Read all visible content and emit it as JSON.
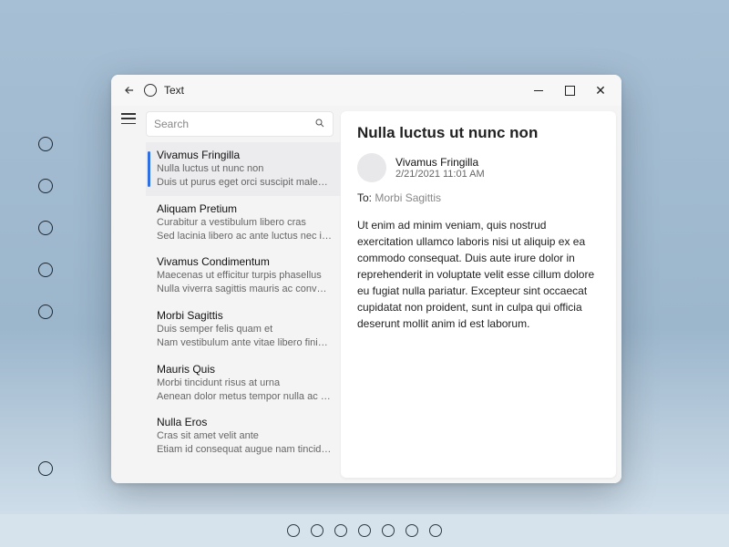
{
  "window": {
    "title": "Text"
  },
  "search": {
    "placeholder": "Search"
  },
  "list": [
    {
      "title": "Vivamus Fringilla",
      "line2": "Nulla luctus ut nunc non",
      "line3": "Duis ut purus eget orci suscipit malesuada",
      "selected": true
    },
    {
      "title": "Aliquam Pretium",
      "line2": "Curabitur a vestibulum libero cras",
      "line3": "Sed lacinia libero ac ante luctus nec interdum",
      "selected": false
    },
    {
      "title": "Vivamus Condimentum",
      "line2": "Maecenas ut efficitur turpis phasellus",
      "line3": "Nulla viverra sagittis mauris ac convallis",
      "selected": false
    },
    {
      "title": "Morbi Sagittis",
      "line2": "Duis semper felis quam et",
      "line3": "Nam vestibulum ante vitae libero finibus et",
      "selected": false
    },
    {
      "title": "Mauris Quis",
      "line2": "Morbi tincidunt risus at urna",
      "line3": "Aenean dolor metus tempor nulla ac dapibus",
      "selected": false
    },
    {
      "title": "Nulla Eros",
      "line2": "Cras sit amet velit ante",
      "line3": "Etiam id consequat augue nam tincidunt",
      "selected": false
    }
  ],
  "detail": {
    "title": "Nulla luctus ut nunc non",
    "sender": "Vivamus Fringilla",
    "date": "2/21/2021 11:01 AM",
    "to_label": "To:",
    "to_value": "Morbi Sagittis",
    "body": "Ut enim ad minim veniam, quis nostrud exercitation ullamco laboris nisi ut aliquip ex ea commodo consequat. Duis aute irure dolor in reprehenderit in voluptate velit esse cillum dolore eu fugiat nulla pariatur. Excepteur sint occaecat cupidatat non proident, sunt in culpa qui officia deserunt mollit anim id est laborum."
  },
  "taskbar_count": 7,
  "side_icon_count": 5
}
